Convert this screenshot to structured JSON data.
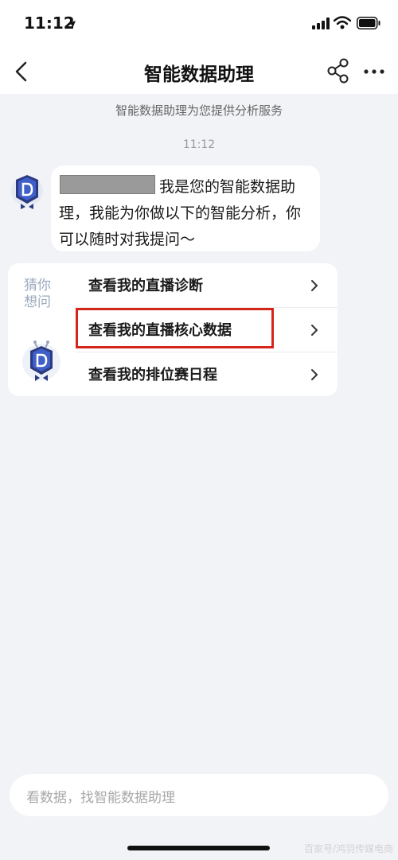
{
  "status_bar": {
    "time": "11:12"
  },
  "header": {
    "title": "智能数据助理"
  },
  "chat": {
    "subtitle": "智能数据助理为您提供分析服务",
    "timestamp": "11:12",
    "message_text": "我是您的智能数据助\n理，我能为你做以下的智能分析，你\n可以随时对我提问～"
  },
  "suggestions": {
    "label": "猜你想问",
    "items": [
      {
        "label": "查看我的直播诊断"
      },
      {
        "label": "查看我的直播核心数据"
      },
      {
        "label": "查看我的排位赛日程"
      }
    ]
  },
  "input": {
    "placeholder": "看数据，找智能数据助理"
  },
  "watermark": "百家号/鸿羽传媒电商"
}
